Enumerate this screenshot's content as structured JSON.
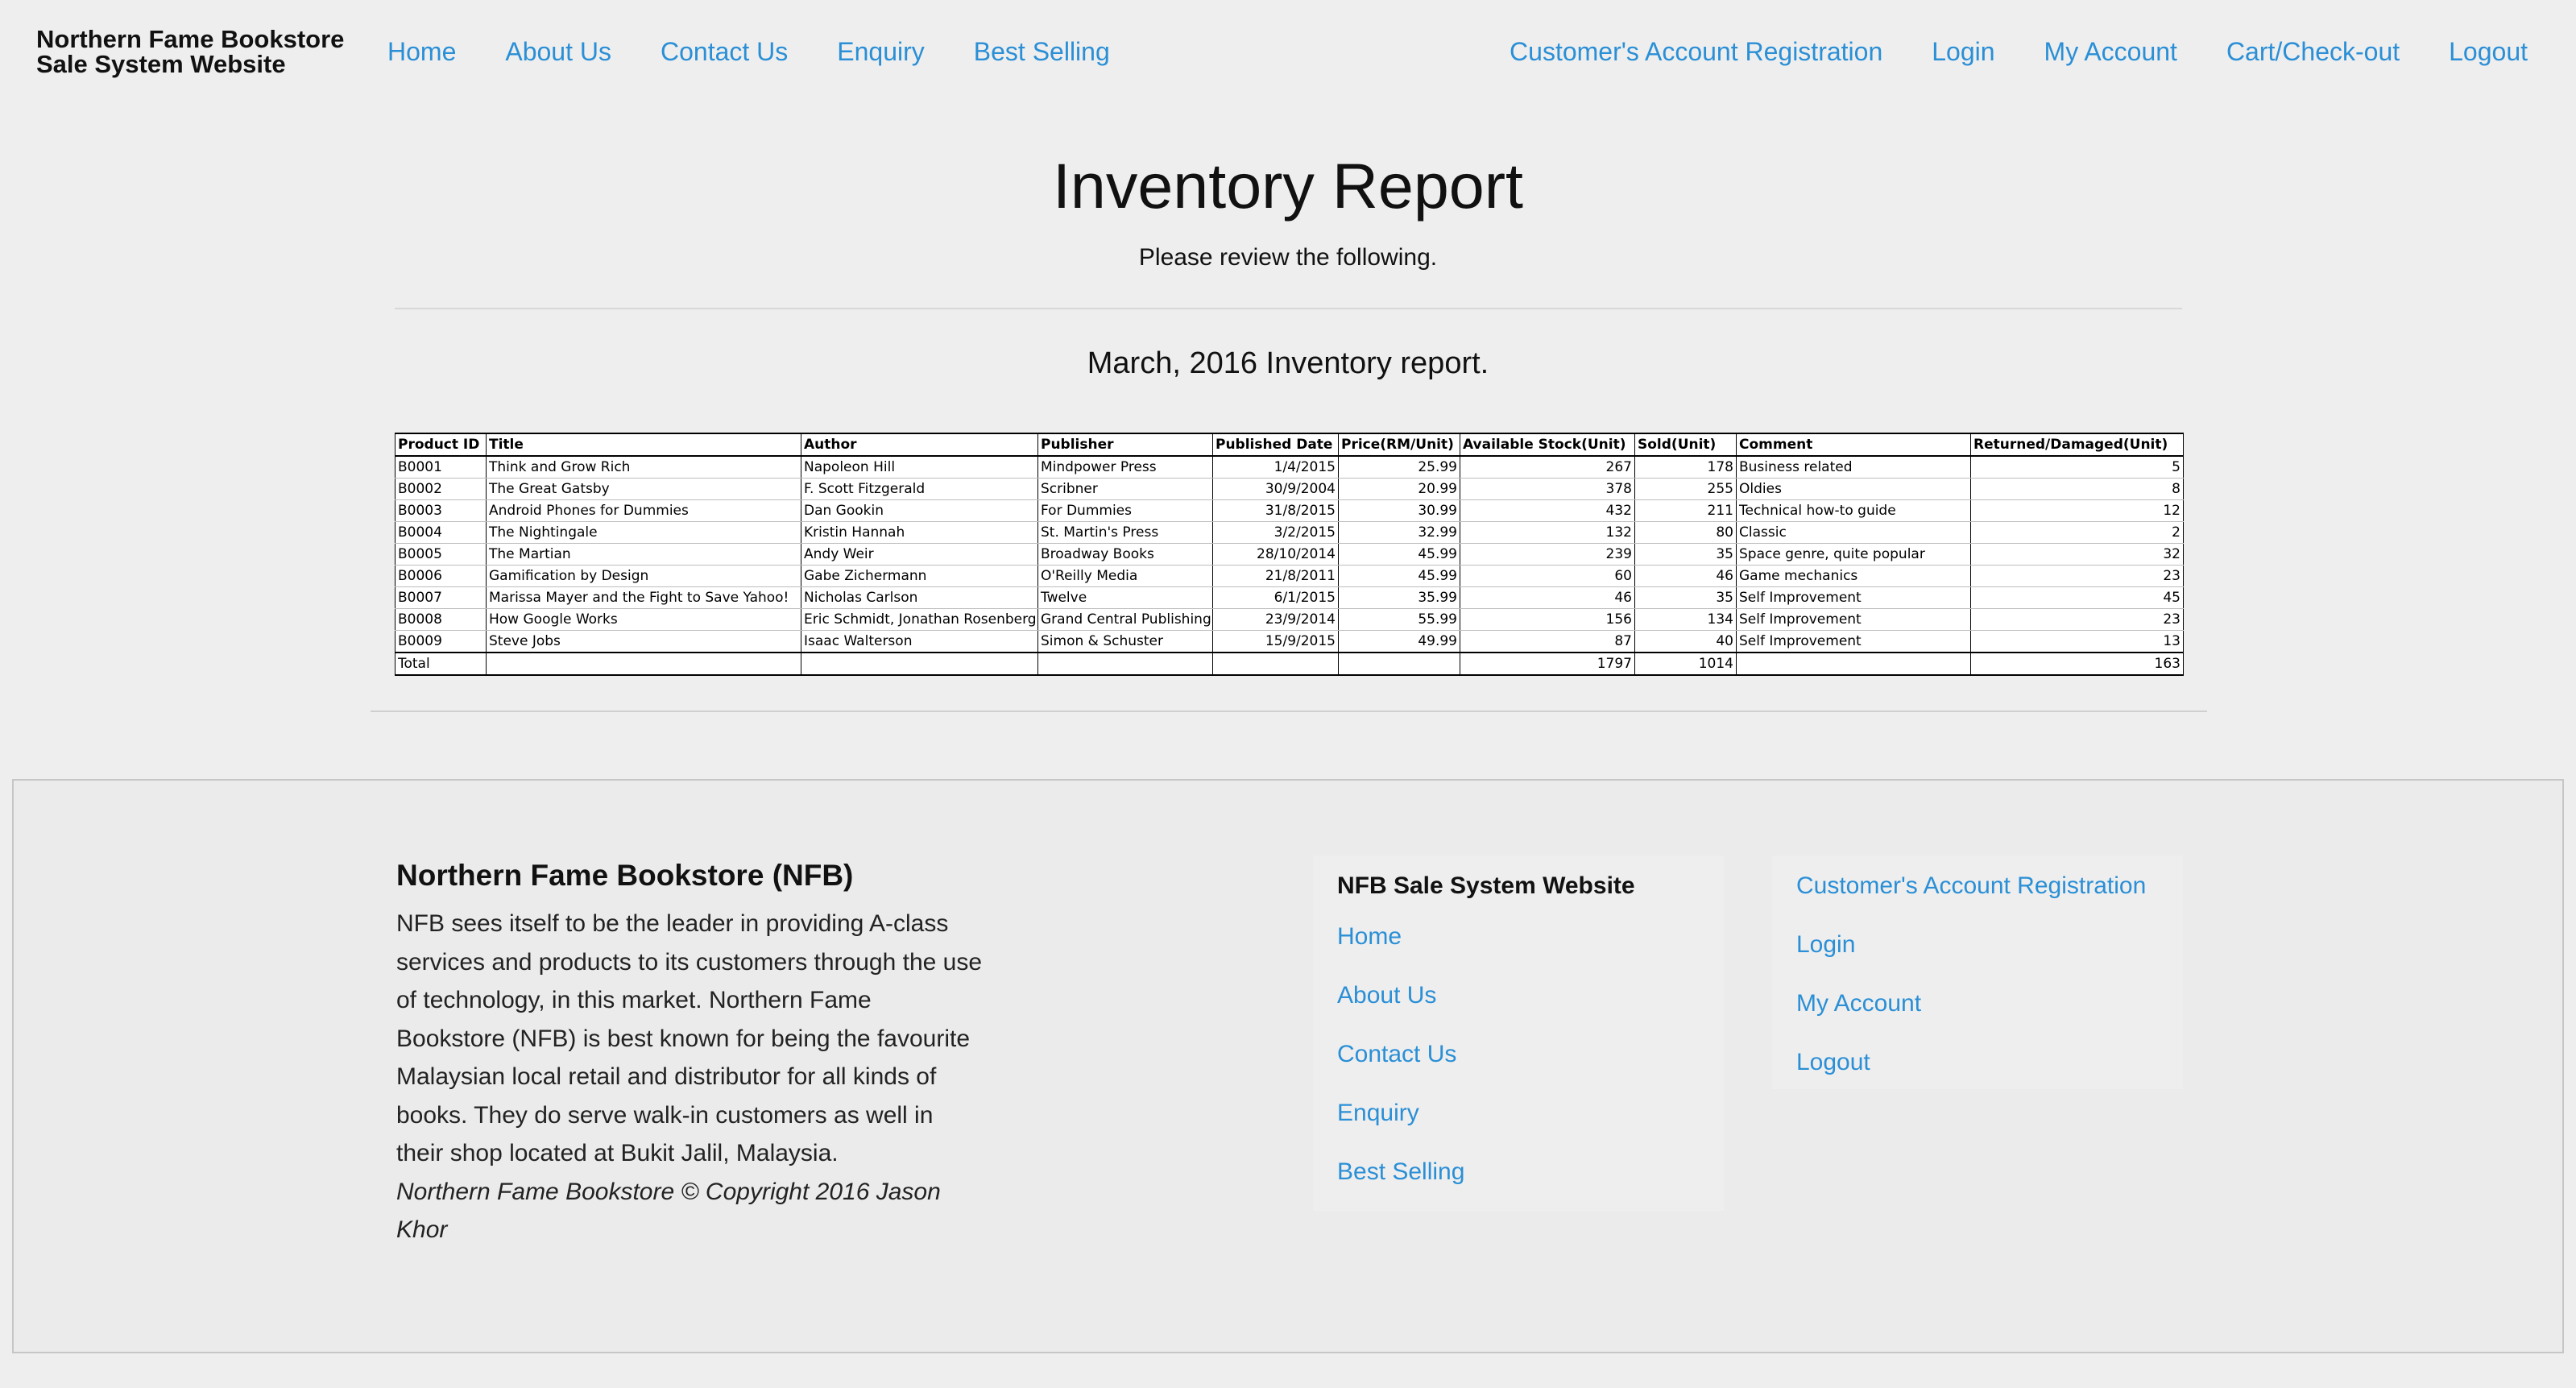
{
  "brand": {
    "line1": "Northern Fame Bookstore",
    "line2": "Sale System Website"
  },
  "nav": {
    "left": [
      "Home",
      "About Us",
      "Contact Us",
      "Enquiry",
      "Best Selling"
    ],
    "right": [
      "Customer's Account Registration",
      "Login",
      "My Account",
      "Cart/Check-out",
      "Logout"
    ]
  },
  "header": {
    "title": "Inventory Report",
    "subtitle": "Please review the following.",
    "report_heading": "March, 2016 Inventory report."
  },
  "table": {
    "columns": [
      "Product ID",
      "Title",
      "Author",
      "Publisher",
      "Published Date",
      "Price(RM/Unit)",
      "Available Stock(Unit)",
      "Sold(Unit)",
      "Comment",
      "Returned/Damaged(Unit)"
    ],
    "rows": [
      [
        "B0001",
        "Think and Grow Rich",
        "Napoleon Hill",
        "Mindpower Press",
        "1/4/2015",
        "25.99",
        "267",
        "178",
        "Business related",
        "5"
      ],
      [
        "B0002",
        "The Great Gatsby",
        "F. Scott Fitzgerald",
        "Scribner",
        "30/9/2004",
        "20.99",
        "378",
        "255",
        "Oldies",
        "8"
      ],
      [
        "B0003",
        "Android Phones for Dummies",
        "Dan Gookin",
        "For Dummies",
        "31/8/2015",
        "30.99",
        "432",
        "211",
        "Technical how-to guide",
        "12"
      ],
      [
        "B0004",
        "The Nightingale",
        "Kristin Hannah",
        "St. Martin's Press",
        "3/2/2015",
        "32.99",
        "132",
        "80",
        "Classic",
        "2"
      ],
      [
        "B0005",
        "The Martian",
        "Andy Weir",
        "Broadway Books",
        "28/10/2014",
        "45.99",
        "239",
        "35",
        "Space genre, quite popular",
        "32"
      ],
      [
        "B0006",
        "Gamification by Design",
        "Gabe Zichermann",
        "O'Reilly Media",
        "21/8/2011",
        "45.99",
        "60",
        "46",
        "Game mechanics",
        "23"
      ],
      [
        "B0007",
        "Marissa Mayer and the Fight to Save Yahoo!",
        "Nicholas Carlson",
        "Twelve",
        "6/1/2015",
        "35.99",
        "46",
        "35",
        "Self Improvement",
        "45"
      ],
      [
        "B0008",
        "How Google Works",
        "Eric Schmidt, Jonathan Rosenberg",
        "Grand Central Publishing",
        "23/9/2014",
        "55.99",
        "156",
        "134",
        "Self Improvement",
        "23"
      ],
      [
        "B0009",
        "Steve Jobs",
        "Isaac Walterson",
        "Simon & Schuster",
        "15/9/2015",
        "49.99",
        "87",
        "40",
        "Self Improvement",
        "13"
      ]
    ],
    "total": [
      "Total",
      "",
      "",
      "",
      "",
      "",
      "1797",
      "1014",
      "",
      "163"
    ]
  },
  "footer": {
    "about_title": "Northern Fame Bookstore (NFB)",
    "about_text": "NFB sees itself to be the leader in providing A-class services and products to its customers through the use of technology, in this market. Northern Fame Bookstore (NFB) is best known for being the favourite Malaysian local retail and distributor for all kinds of books. They do serve walk-in customers as well in their shop located at Bukit Jalil, Malaysia.",
    "copyright": "Northern Fame Bookstore © Copyright 2016 Jason Khor",
    "col1_title": "NFB Sale System Website",
    "col1_links": [
      "Home",
      "About Us",
      "Contact Us",
      "Enquiry",
      "Best Selling"
    ],
    "col2_links": [
      "Customer's Account Registration",
      "Login",
      "My Account",
      "Logout"
    ]
  },
  "colors": {
    "link": "#2a8fd6",
    "background": "#eeeeee",
    "text": "#111111"
  }
}
